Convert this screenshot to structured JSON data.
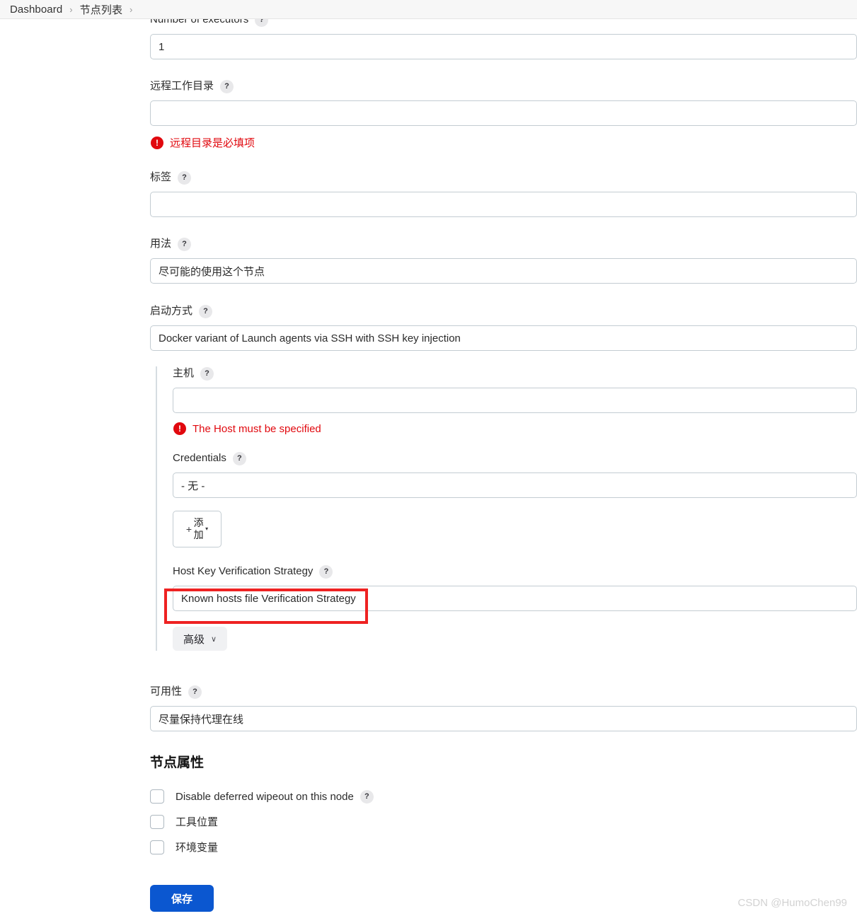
{
  "breadcrumb": {
    "items": [
      "Dashboard",
      "节点列表"
    ],
    "separator": "›"
  },
  "icons": {
    "help": "?",
    "error": "!",
    "chevron_down": "∨",
    "plus": "+",
    "caret_down": "▾"
  },
  "form": {
    "executors": {
      "label": "Number of executors",
      "value": "1"
    },
    "remote_root_dir": {
      "label": "远程工作目录",
      "value": "",
      "error": "远程目录是必填项"
    },
    "labels": {
      "label": "标签",
      "value": ""
    },
    "usage": {
      "label": "用法",
      "value": "尽可能的使用这个节点"
    },
    "launch_method": {
      "label": "启动方式",
      "value": "Docker variant of Launch agents via SSH with SSH key injection"
    },
    "ssh": {
      "host": {
        "label": "主机",
        "value": "",
        "error": "The Host must be specified"
      },
      "credentials": {
        "label": "Credentials",
        "value": "- 无 -"
      },
      "add_button": {
        "label": "添加"
      },
      "host_key_strategy": {
        "label": "Host Key Verification Strategy",
        "value": "Known hosts file Verification Strategy"
      },
      "advanced_button": {
        "label": "高级"
      }
    },
    "availability": {
      "label": "可用性",
      "value": "尽量保持代理在线"
    }
  },
  "node_properties": {
    "title": "节点属性",
    "items": [
      {
        "label": "Disable deferred wipeout on this node",
        "checked": false,
        "has_help": true
      },
      {
        "label": "工具位置",
        "checked": false,
        "has_help": false
      },
      {
        "label": "环境变量",
        "checked": false,
        "has_help": false
      }
    ]
  },
  "actions": {
    "save": "保存"
  },
  "watermark": "CSDN @HumoChen99",
  "colors": {
    "accent": "#0b57d0",
    "error": "#e1080e",
    "annotation": "#ee2222",
    "input_border": "#c3ccd2"
  }
}
